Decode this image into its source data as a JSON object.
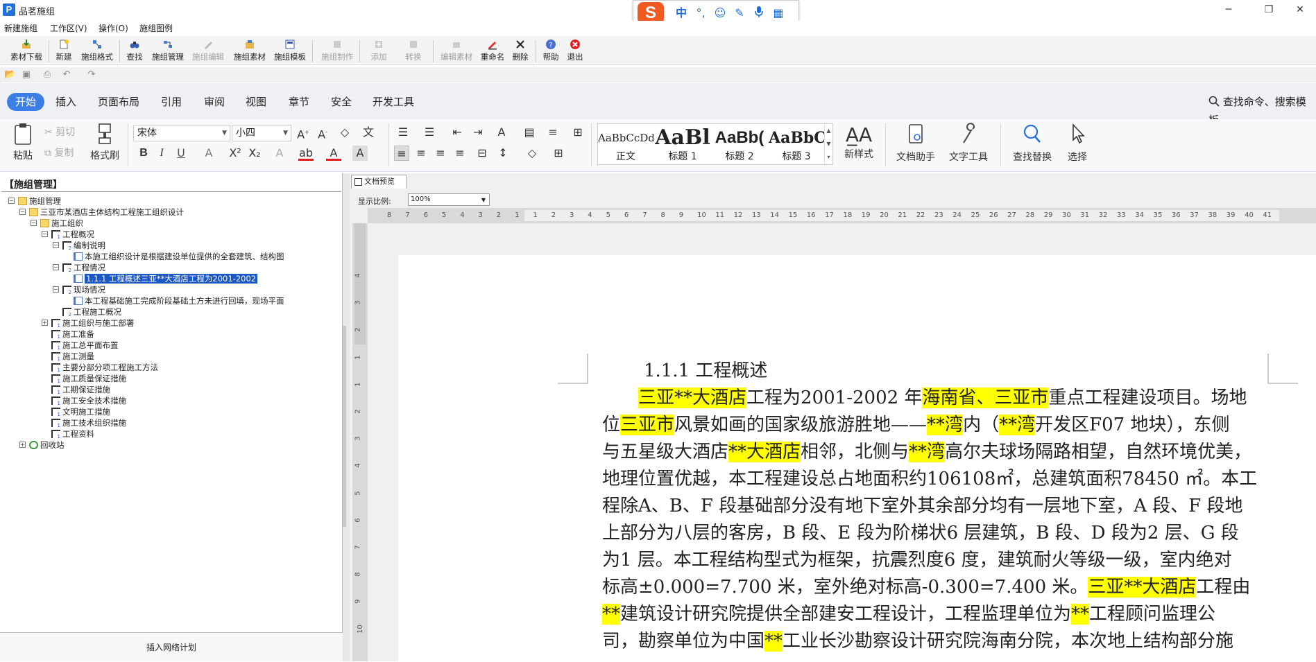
{
  "app": {
    "title": "品茗施组",
    "logo": "P"
  },
  "window_controls": {
    "minimize": "─",
    "maximize": "❐",
    "close": "✕"
  },
  "ime": {
    "logo": "S",
    "lang": "中",
    "punct": "°,",
    "emoji": "☺",
    "skin": "✎",
    "mic": "🎤",
    "grid": "▦"
  },
  "menubar": [
    "新建施组",
    "工作区(V)",
    "操作(O)",
    "施组图例"
  ],
  "toolbar1": [
    {
      "label": "素材下载",
      "enabled": true
    },
    {
      "label": "新建",
      "enabled": true
    },
    {
      "label": "施组格式",
      "enabled": true
    },
    {
      "label": "查找",
      "enabled": true
    },
    {
      "label": "施组管理",
      "enabled": true
    },
    {
      "label": "施组编辑",
      "enabled": false
    },
    {
      "label": "施组素材",
      "enabled": true
    },
    {
      "label": "施组模板",
      "enabled": true
    },
    {
      "label": "施组制作",
      "enabled": false
    },
    {
      "label": "添加",
      "enabled": false
    },
    {
      "label": "转换",
      "enabled": false
    },
    {
      "label": "编辑素材",
      "enabled": false
    },
    {
      "label": "重命名",
      "enabled": true
    },
    {
      "label": "删除",
      "enabled": true
    },
    {
      "label": "帮助",
      "enabled": true
    },
    {
      "label": "退出",
      "enabled": true
    }
  ],
  "ribbon_tabs": [
    "开始",
    "插入",
    "页面布局",
    "引用",
    "审阅",
    "视图",
    "章节",
    "安全",
    "开发工具"
  ],
  "search_cmd": "查找命令、搜索模板",
  "ribbon": {
    "paste": "粘贴",
    "cut": "剪切",
    "copy": "复制",
    "format_painter": "格式刷",
    "font_name": "宋体",
    "font_size": "小四",
    "styles": [
      {
        "preview": "AaBbCcDd",
        "name": "正文"
      },
      {
        "preview": "AaBl",
        "name": "标题 1"
      },
      {
        "preview": "AaBb(",
        "name": "标题 2"
      },
      {
        "preview": "AaBbC",
        "name": "标题 3"
      }
    ],
    "new_style": "新样式",
    "doc_helper": "文档助手",
    "text_tools": "文字工具",
    "find_replace": "查找替换",
    "select": "选择"
  },
  "left_panel": {
    "title": "【施组管理】",
    "tree": [
      {
        "label": "施组管理",
        "indent": 0,
        "icon": "folder",
        "expander": "−"
      },
      {
        "label": "三亚市某酒店主体结构工程施工组织设计",
        "indent": 1,
        "icon": "folder",
        "expander": "−"
      },
      {
        "label": "施工组织",
        "indent": 2,
        "icon": "folder",
        "expander": "−"
      },
      {
        "label": "工程概况",
        "indent": 3,
        "icon": "lvl1",
        "expander": "−"
      },
      {
        "label": "编制说明",
        "indent": 4,
        "icon": "lvl2",
        "expander": "−"
      },
      {
        "label": "本施工组织设计是根据建设单位提供的全套建筑、结构图",
        "indent": 5,
        "icon": "doc",
        "expander": ""
      },
      {
        "label": "工程情况",
        "indent": 4,
        "icon": "lvl2",
        "expander": "−"
      },
      {
        "label": "1.1.1 工程概述三亚**大酒店工程为2001-2002",
        "indent": 5,
        "icon": "doc",
        "expander": "",
        "selected": true
      },
      {
        "label": "现场情况",
        "indent": 4,
        "icon": "lvl2",
        "expander": "−"
      },
      {
        "label": "本工程基础施工完成阶段基础土方未进行回填，现场平面",
        "indent": 5,
        "icon": "doc",
        "expander": ""
      },
      {
        "label": "工程施工概况",
        "indent": 4,
        "icon": "lvl2",
        "expander": ""
      },
      {
        "label": "施工组织与施工部署",
        "indent": 3,
        "icon": "lvl1",
        "expander": "+"
      },
      {
        "label": "施工准备",
        "indent": 3,
        "icon": "lvl1",
        "expander": ""
      },
      {
        "label": "施工总平面布置",
        "indent": 3,
        "icon": "lvl1",
        "expander": ""
      },
      {
        "label": "施工测量",
        "indent": 3,
        "icon": "lvl1",
        "expander": ""
      },
      {
        "label": "主要分部分项工程施工方法",
        "indent": 3,
        "icon": "lvl1",
        "expander": ""
      },
      {
        "label": "施工质量保证措施",
        "indent": 3,
        "icon": "lvl1",
        "expander": ""
      },
      {
        "label": "工期保证措施",
        "indent": 3,
        "icon": "lvl1",
        "expander": ""
      },
      {
        "label": "施工安全技术措施",
        "indent": 3,
        "icon": "lvl1",
        "expander": ""
      },
      {
        "label": "文明施工措施",
        "indent": 3,
        "icon": "lvl1",
        "expander": ""
      },
      {
        "label": "施工技术组织措施",
        "indent": 3,
        "icon": "lvl1",
        "expander": ""
      },
      {
        "label": "工程资料",
        "indent": 3,
        "icon": "lvl1",
        "expander": ""
      },
      {
        "label": "回收站",
        "indent": 1,
        "icon": "recycle",
        "expander": "+"
      }
    ],
    "bottom_button": "插入网络计划"
  },
  "preview": {
    "tab": "文档预览",
    "zoom_label": "显示比例:",
    "zoom_value": "100%",
    "hruler": [
      "8",
      "7",
      "6",
      "5",
      "4",
      "3",
      "2",
      "1",
      "1",
      "2",
      "3",
      "4",
      "5",
      "6",
      "7",
      "8",
      "9",
      "10",
      "11",
      "12",
      "13",
      "14",
      "15",
      "16",
      "17",
      "18",
      "19",
      "20",
      "21",
      "22",
      "23",
      "24",
      "25",
      "26",
      "27",
      "28",
      "29",
      "30",
      "31",
      "32",
      "33",
      "34",
      "35",
      "36",
      "37",
      "38",
      "39",
      "40",
      "41"
    ],
    "vruler": [
      "4",
      "3",
      "2",
      "1",
      "1",
      "2",
      "3",
      "4",
      "5",
      "6",
      "7",
      "8",
      "9",
      "10"
    ],
    "doc_lines": [
      [
        {
          "t": "1.1.1 工程概述"
        }
      ],
      [
        {
          "t": "　　"
        },
        {
          "t": "三亚**大酒店",
          "hl": true
        },
        {
          "t": "工程为2001-2002 年"
        },
        {
          "t": "海南省、三亚市",
          "hl": true
        },
        {
          "t": "重点工程建设项目。场地"
        }
      ],
      [
        {
          "t": "位"
        },
        {
          "t": "三亚市",
          "hl": true
        },
        {
          "t": "风景如画的国家级旅游胜地——"
        },
        {
          "t": "**湾",
          "hl": true
        },
        {
          "t": "内（"
        },
        {
          "t": "**湾",
          "hl": true
        },
        {
          "t": "开发区F07 地块），东侧"
        }
      ],
      [
        {
          "t": "与五星级大酒店"
        },
        {
          "t": "**大酒店",
          "hl": true
        },
        {
          "t": "相邻，北侧与"
        },
        {
          "t": "**湾",
          "hl": true
        },
        {
          "t": "高尔夫球场隔路相望，自然环境优美，"
        }
      ],
      [
        {
          "t": "地理位置优越，本工程建设总占地面积约106108㎡，总建筑面积78450 ㎡。本工"
        }
      ],
      [
        {
          "t": "程除A、B、F 段基础部分没有地下室外其余部分均有一层地下室，A 段、F 段地"
        }
      ],
      [
        {
          "t": "上部分为八层的客房，B 段、E 段为阶梯状6 层建筑，B 段、D 段为2 层、G 段"
        }
      ],
      [
        {
          "t": "为1 层。本工程结构型式为框架，抗震烈度6 度，建筑耐火等级一级，室内绝对"
        }
      ],
      [
        {
          "t": "标高±0.000=7.700 米，室外绝对标高-0.300=7.400 米。"
        },
        {
          "t": "三亚**大酒店",
          "hl": true
        },
        {
          "t": "工程由"
        }
      ],
      [
        {
          "t": "**",
          "hl": true
        },
        {
          "t": "建筑设计研究院提供全部建安工程设计，工程监理单位为"
        },
        {
          "t": "**",
          "hl": true
        },
        {
          "t": "工程顾问监理公"
        }
      ],
      [
        {
          "t": "司，勘察单位为中国"
        },
        {
          "t": "**",
          "hl": true
        },
        {
          "t": "工业长沙勘察设计研究院海南分院，本次地上结构部分施"
        }
      ]
    ]
  }
}
